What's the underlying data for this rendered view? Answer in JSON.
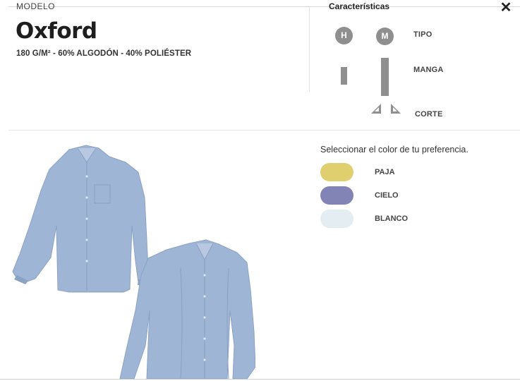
{
  "header": {
    "section_label": "MODELO",
    "title": "Oxford",
    "spec": "180 G/M² - 60% ALGODÓN - 40% POLIÉSTER",
    "close_icon": "close-icon"
  },
  "features": {
    "title": "Características",
    "type": {
      "label": "TIPO",
      "options": [
        "H",
        "M"
      ]
    },
    "sleeve": {
      "label": "MANGA",
      "icons": [
        "short-sleeve-icon",
        "long-sleeve-icon"
      ]
    },
    "cut": {
      "label": "CORTE",
      "icons": [
        "cut-left-icon",
        "cut-right-icon"
      ]
    },
    "icon_color": "#8f8f8f"
  },
  "colors": {
    "prompt": "Seleccionar el color de tu preferencia.",
    "options": [
      {
        "name": "PAJA",
        "swatch": "#e0cf6e"
      },
      {
        "name": "CIELO",
        "swatch": "#8384b6"
      },
      {
        "name": "BLANCO",
        "swatch": "#e4edf1"
      }
    ]
  },
  "product_image": {
    "icon": "shirts-photo",
    "shirt_color": "#9fb5d5"
  }
}
